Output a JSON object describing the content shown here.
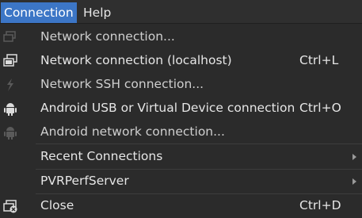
{
  "menubar": {
    "connection_label": "Connection",
    "help_label": "Help"
  },
  "menu": {
    "items": [
      {
        "label": "Network connection...",
        "shortcut": "",
        "icon": "network-icon"
      },
      {
        "label": "Network connection (localhost)",
        "shortcut": "Ctrl+L",
        "icon": "network-localhost-icon"
      },
      {
        "label": "Network SSH connection...",
        "shortcut": "",
        "icon": "ssh-icon"
      },
      {
        "label": "Android USB or Virtual Device connection",
        "shortcut": "Ctrl+O",
        "icon": "android-icon"
      },
      {
        "label": "Android network connection...",
        "shortcut": "",
        "icon": "android-network-icon"
      },
      {
        "label": "Recent Connections",
        "shortcut": "",
        "submenu": true
      },
      {
        "label": "PVRPerfServer",
        "shortcut": "",
        "submenu": true
      },
      {
        "label": "Close",
        "shortcut": "Ctrl+D",
        "icon": "close-connection-icon"
      }
    ]
  },
  "colors": {
    "highlight": "#3c76c6",
    "background": "#2b2b2b",
    "text": "#e6e6e6"
  }
}
